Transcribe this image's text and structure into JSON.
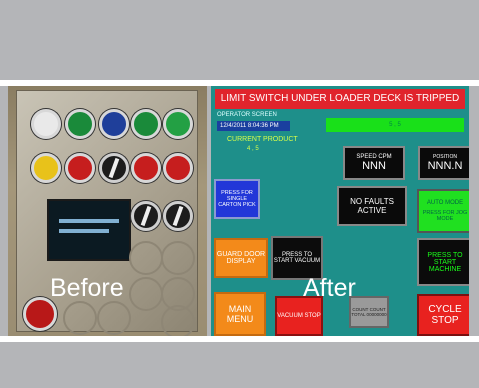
{
  "captions": {
    "before": "Before",
    "after": "After"
  },
  "operator_screen": {
    "alarm_banner": "LIMIT SWITCH UNDER LOADER DECK IS TRIPPED",
    "title": "OPERATOR SCREEN",
    "datetime": "12/4/2011 8:04:36 PM",
    "current_product_label": "CURRENT PRODUCT",
    "current_product_value": "4 , 5",
    "status_bar_text": "5 , 5",
    "speed_caption": "SPEED CPM",
    "speed_value": "NNN",
    "position_caption": "POSITION",
    "position_value": "NNN.N",
    "faults_text": "NO FAULTS ACTIVE",
    "auto_mode_caption": "AUTO MODE",
    "auto_mode_sub": "PRESS FOR JOG MODE",
    "press_single_label": "PRESS FOR SINGLE CARTON PICK",
    "guard_door_label": "GUARD DOOR DISPLAY",
    "press_vacuum_label": "PRESS TO START VACUUM",
    "press_machine_label": "PRESS TO START MACHINE",
    "main_menu_label": "MAIN MENU",
    "vacuum_stop_label": "VACUUM STOP",
    "count_label": "COUNT COUNT TOTAL 00000000",
    "cycle_stop_label": "CYCLE STOP"
  },
  "colors": {
    "background": "#b4b5b8",
    "screen_teal": "#1e8f8a",
    "alarm_red": "#e0242c",
    "status_green": "#19e019",
    "button_orange": "#f38a1a",
    "button_blue": "#2237d8"
  }
}
